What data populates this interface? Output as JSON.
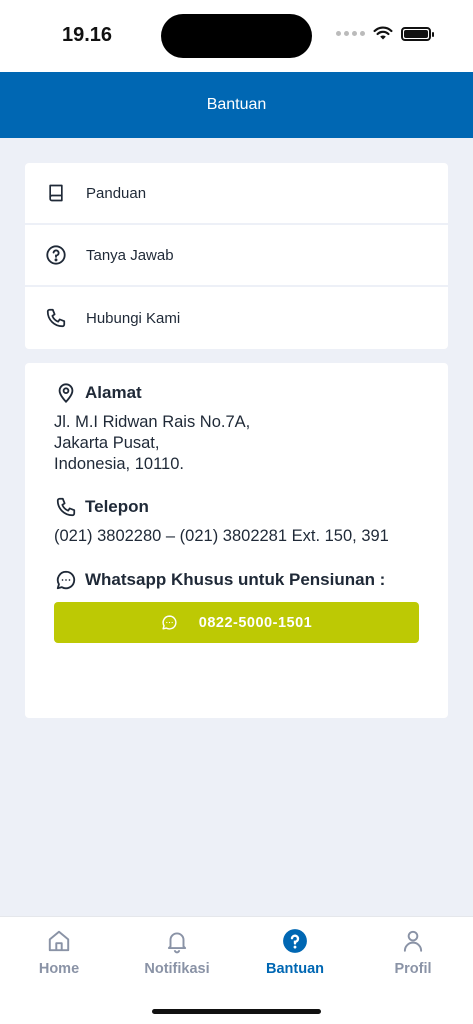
{
  "status_bar": {
    "time": "19.16"
  },
  "header": {
    "title": "Bantuan"
  },
  "menu": {
    "items": [
      {
        "label": "Panduan",
        "icon": "book-icon"
      },
      {
        "label": "Tanya Jawab",
        "icon": "question-circle-icon"
      },
      {
        "label": "Hubungi Kami",
        "icon": "phone-icon"
      }
    ]
  },
  "contact": {
    "address": {
      "title": "Alamat",
      "lines": [
        "Jl. M.I Ridwan Rais No.7A,",
        "Jakarta Pusat,",
        "Indonesia, 10110."
      ]
    },
    "phone": {
      "title": "Telepon",
      "text": "(021) 3802280 – (021) 3802281 Ext. 150, 391"
    },
    "whatsapp": {
      "title": "Whatsapp Khusus untuk Pensiunan :",
      "button_label": "0822-5000-1501"
    }
  },
  "bottom_nav": {
    "items": [
      {
        "label": "Home",
        "icon": "home-icon",
        "active": false
      },
      {
        "label": "Notifikasi",
        "icon": "bell-icon",
        "active": false
      },
      {
        "label": "Bantuan",
        "icon": "help-icon",
        "active": true
      },
      {
        "label": "Profil",
        "icon": "user-icon",
        "active": false
      }
    ]
  },
  "colors": {
    "primary": "#0067b3",
    "whatsapp_button": "#bdc904",
    "background": "#edf0f7",
    "inactive_nav": "#8a93a6"
  }
}
